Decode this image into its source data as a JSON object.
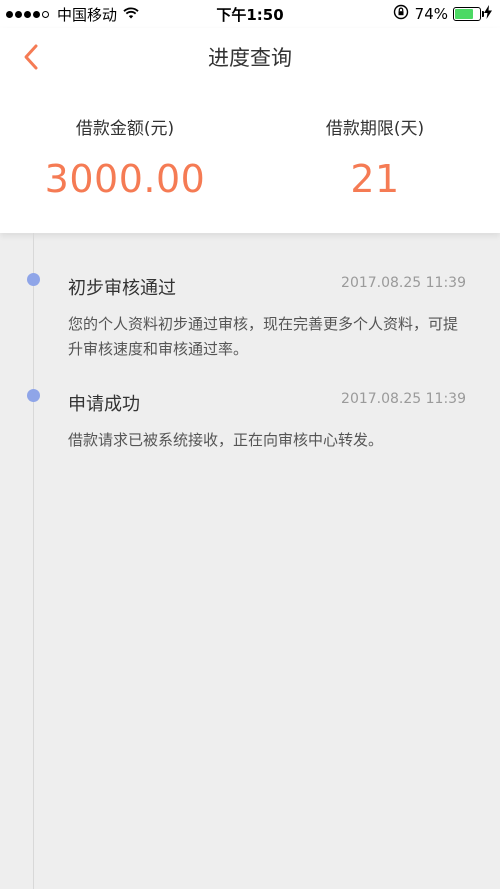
{
  "status_bar": {
    "carrier": "中国移动",
    "time": "下午1:50",
    "battery_percent": "74%",
    "battery_level": 0.74,
    "battery_color": "#4cd964"
  },
  "nav": {
    "back_icon": "chevron-left-icon",
    "title": "进度查询",
    "accent_color": "#f57b54"
  },
  "summary": {
    "amount_label": "借款金额(元)",
    "amount_value": "3000.00",
    "term_label": "借款期限(天)",
    "term_value": "21"
  },
  "timeline": [
    {
      "title": "初步审核通过",
      "time": "2017.08.25 11:39",
      "description": "您的个人资料初步通过审核，现在完善更多个人资料，可提升审核速度和审核通过率。"
    },
    {
      "title": "申请成功",
      "time": "2017.08.25 11:39",
      "description": "借款请求已被系统接收，正在向审核中心转发。"
    }
  ]
}
